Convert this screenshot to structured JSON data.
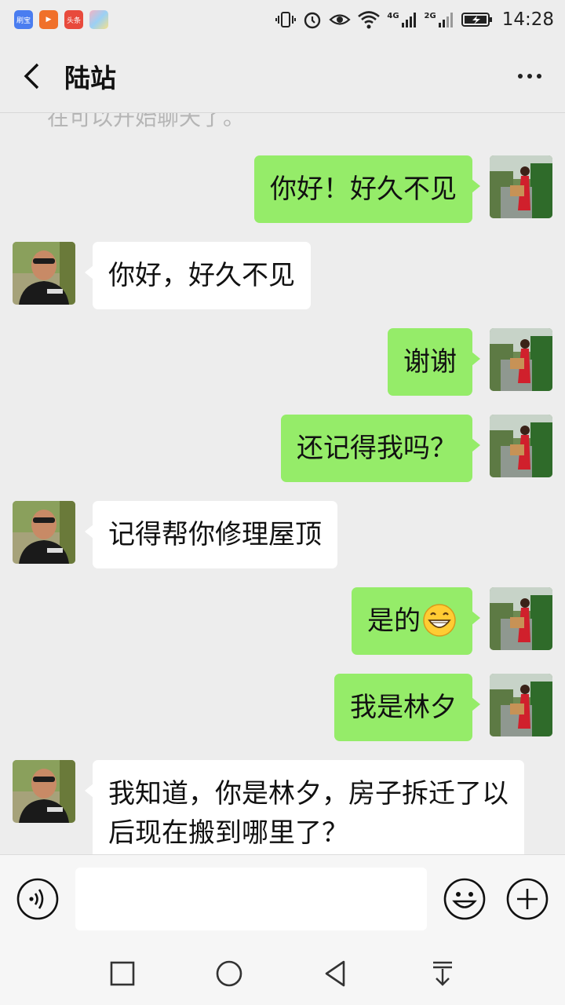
{
  "status_bar": {
    "time": "14:28",
    "apps": [
      {
        "label": "刷宝",
        "color": "#4a7df0"
      },
      {
        "label": "▶",
        "color": "#f0702a"
      },
      {
        "label": "头条",
        "color": "#e84a3c"
      },
      {
        "label": "",
        "color": "#f3b4c4"
      }
    ],
    "sig1": "4G",
    "sig2": "2G"
  },
  "header": {
    "title": "陆站"
  },
  "chat": {
    "system_tip": "在可以开始聊天了。",
    "messages": [
      {
        "side": "right",
        "text": "你好！好久不见"
      },
      {
        "side": "left",
        "text": "你好，好久不见"
      },
      {
        "side": "right",
        "text": "谢谢"
      },
      {
        "side": "right",
        "text": "还记得我吗？"
      },
      {
        "side": "left",
        "text": "记得帮你修理屋顶"
      },
      {
        "side": "right",
        "text": "是的",
        "emoji": "grinning-face-emoji"
      },
      {
        "side": "right",
        "text": "我是林夕"
      },
      {
        "side": "left",
        "text": "我知道，你是林夕，房子拆迁了以后现在搬到哪里了？"
      }
    ]
  },
  "input_bar": {
    "value": "",
    "icons": [
      "voice-icon",
      "emoji-icon",
      "plus-icon"
    ]
  },
  "nav_bar": {
    "icons": [
      "recent-apps-icon",
      "home-icon",
      "back-icon",
      "notification-pull-icon"
    ]
  },
  "colors": {
    "background": "#ededed",
    "sent_bubble": "#95ec69",
    "received_bubble": "#ffffff"
  }
}
